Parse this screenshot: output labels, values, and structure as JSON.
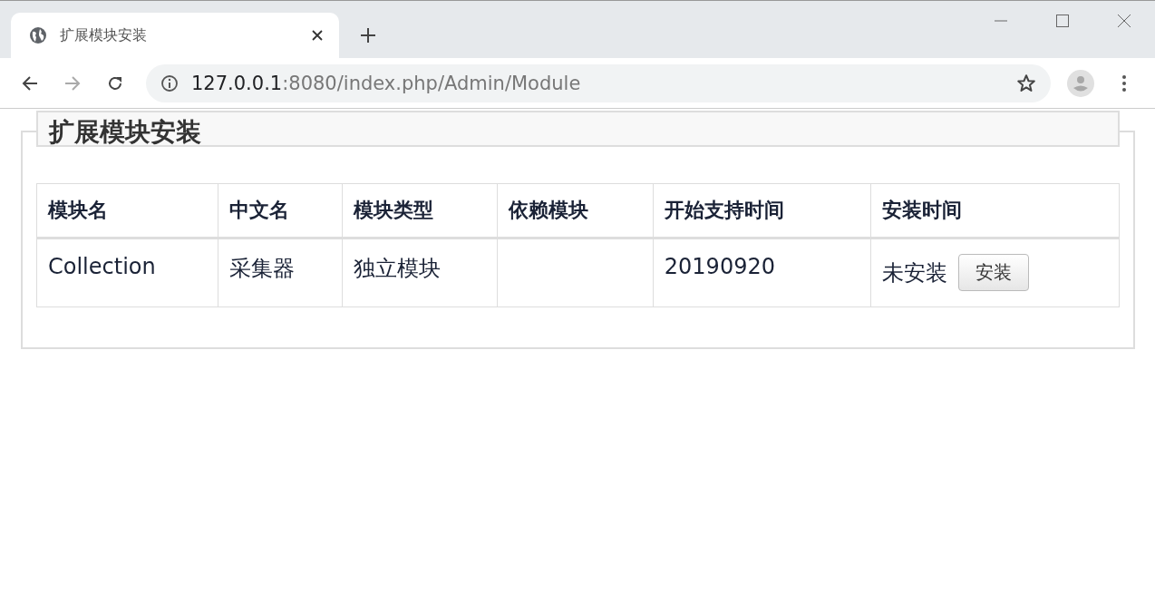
{
  "browser": {
    "tab": {
      "title": "扩展模块安装",
      "selected": true
    },
    "address": {
      "host": "127.0.0.1",
      "path": ":8080/index.php/Admin/Module"
    }
  },
  "page": {
    "heading": "扩展模块安装",
    "table": {
      "columns": [
        "模块名",
        "中文名",
        "模块类型",
        "依赖模块",
        "开始支持时间",
        "安装时间"
      ],
      "rows": [
        {
          "cells": [
            {
              "kind": "text",
              "text": "Collection"
            },
            {
              "kind": "text",
              "text": "采集器"
            },
            {
              "kind": "text",
              "text": "独立模块"
            },
            {
              "kind": "empty"
            },
            {
              "kind": "text",
              "text": "20190920"
            },
            {
              "kind": "action",
              "text": "未安装",
              "button": "安装"
            }
          ]
        }
      ]
    }
  }
}
